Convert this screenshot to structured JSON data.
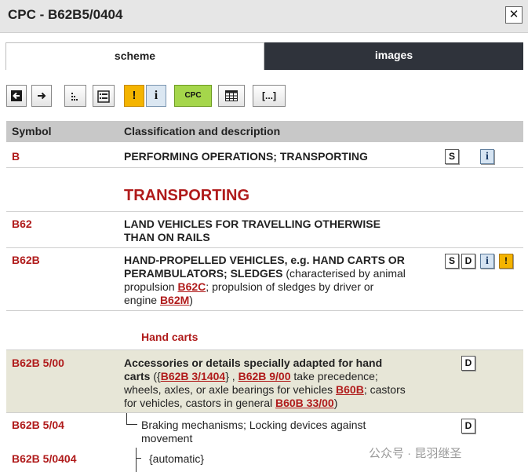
{
  "window": {
    "title": "CPC - B62B5/0404",
    "close_glyph": "✕"
  },
  "tabs": [
    {
      "label": "scheme",
      "active": true
    },
    {
      "label": "images",
      "active": false
    }
  ],
  "toolbar": {
    "cpc_label": "CPC",
    "bracket_label": "[...]",
    "warn_glyph": "!",
    "info_glyph": "i"
  },
  "table": {
    "headers": {
      "symbol": "Symbol",
      "description": "Classification and description"
    },
    "rows": [
      {
        "symbol": "B",
        "title": "PERFORMING OPERATIONS; TRANSPORTING",
        "icons": [
          "S",
          "i"
        ]
      },
      {
        "section_title": "TRANSPORTING"
      },
      {
        "symbol": "B62",
        "title_line1": "LAND VEHICLES FOR TRAVELLING OTHERWISE",
        "title_line2": "THAN ON RAILS"
      },
      {
        "symbol": "B62B",
        "title_line1": "HAND-PROPELLED VEHICLES, e.g. HAND CARTS OR",
        "title_line2": "PERAMBULATORS; SLEDGES",
        "text_a": " (characterised by animal",
        "text_b": "propulsion ",
        "link_a": "B62C",
        "text_c": "; propulsion of sledges by driver or",
        "text_d": "engine ",
        "link_b": "B62M",
        "text_e": ")",
        "icons": [
          "S",
          "D",
          "i",
          "!"
        ]
      },
      {
        "subheading": "Hand carts"
      },
      {
        "symbol": "B62B 5/00",
        "title_line1": "Accessories or details specially adapted for hand",
        "title_line2": "carts",
        "text_a": " ({",
        "link_a": "B62B 3/1404",
        "text_b": "} , ",
        "link_b": "B62B 9/00",
        "text_c": " take precedence;",
        "text_d": "wheels, axles, or axle bearings for vehicles ",
        "link_c": "B60B",
        "text_e": "; castors",
        "text_f": "for vehicles, castors in general ",
        "link_d": "B60B 33/00",
        "text_g": ")",
        "icons": [
          "D"
        ]
      },
      {
        "symbol": "B62B 5/04",
        "line1": "Braking mechanisms; Locking devices against",
        "line2": "movement",
        "icons": [
          "D"
        ]
      },
      {
        "symbol": "B62B 5/0404",
        "line1": "{automatic}"
      }
    ]
  },
  "watermark": "公众号 · 昆羽继圣",
  "colors": {
    "accent": "#b01b1b",
    "header_bg": "#c8c8c8",
    "highlight_row": "#e7e6d7",
    "tab_dark": "#2f333b"
  }
}
